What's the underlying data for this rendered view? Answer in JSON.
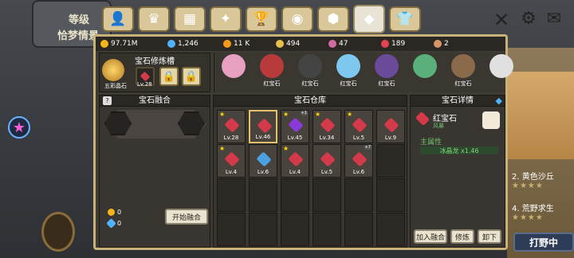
{
  "background": {
    "left_title": "等级",
    "left_sub": "恰梦情景",
    "right_items": [
      {
        "label": "2. 黄色沙丘",
        "stars": "★★★★"
      },
      {
        "label": "4. 荒野求生",
        "stars": "★★★★"
      }
    ],
    "hunt_button": "打野中"
  },
  "tabs": [
    {
      "icon": "character-icon",
      "glyph": "👤"
    },
    {
      "icon": "crown-icon",
      "glyph": "♛"
    },
    {
      "icon": "castle-icon",
      "glyph": "▦"
    },
    {
      "icon": "wand-icon",
      "glyph": "✦"
    },
    {
      "icon": "trophy-icon",
      "glyph": "🏆"
    },
    {
      "icon": "eye-orb-icon",
      "glyph": "◉"
    },
    {
      "icon": "shield-orb-icon",
      "glyph": "⬢"
    },
    {
      "icon": "gem-tab-icon",
      "glyph": "◆"
    },
    {
      "icon": "shirt-icon",
      "glyph": "👕"
    }
  ],
  "resources": [
    {
      "icon": "gold-icon",
      "value": "97.71M",
      "color": "#f3b519"
    },
    {
      "icon": "diamond-icon",
      "value": "1,246",
      "color": "#4fb3ff"
    },
    {
      "icon": "coin-icon",
      "value": "11 K",
      "color": "#f39a19"
    },
    {
      "icon": "wings-icon",
      "value": "494",
      "color": "#e6c04a"
    },
    {
      "icon": "ticket-icon",
      "value": "47",
      "color": "#d46aa3"
    },
    {
      "icon": "ruby-icon",
      "value": "189",
      "color": "#e04455"
    },
    {
      "icon": "donut-icon",
      "value": "2",
      "color": "#d99565"
    }
  ],
  "slot": {
    "title": "宝石修炼槽",
    "avatar_name": "五彩晶石",
    "gem_level": "Lv.28"
  },
  "monsters": [
    {
      "label": "",
      "color": "#e8a0c0"
    },
    {
      "label": "红宝石",
      "color": "#b83a3a"
    },
    {
      "label": "红宝石",
      "color": "#444"
    },
    {
      "label": "红宝石",
      "color": "#7ec8f0"
    },
    {
      "label": "红宝石",
      "color": "#6a4a9a"
    },
    {
      "label": "",
      "color": "#5ab07a"
    },
    {
      "label": "红宝石",
      "color": "#8a6a4a"
    },
    {
      "label": "",
      "color": "#e0e0e0"
    }
  ],
  "fusion": {
    "title": "宝石融合",
    "res1": "0",
    "res2": "0",
    "button": "开始融合"
  },
  "warehouse": {
    "title": "宝石仓库",
    "items": [
      {
        "lv": "Lv.28",
        "color": "#d43a4a",
        "star": true,
        "tag": ""
      },
      {
        "lv": "Lv.46",
        "color": "#d43a4a",
        "star": false,
        "tag": "",
        "selected": true
      },
      {
        "lv": "Lv.45",
        "color": "#8a3ad8",
        "star": true,
        "tag": "+1"
      },
      {
        "lv": "Lv.34",
        "color": "#d43a4a",
        "star": true,
        "tag": ""
      },
      {
        "lv": "Lv.5",
        "color": "#d43a4a",
        "star": true,
        "tag": ""
      },
      {
        "lv": "Lv.9",
        "color": "#d43a4a",
        "star": false,
        "tag": ""
      },
      {
        "lv": "Lv.4",
        "color": "#d43a4a",
        "star": true,
        "tag": ""
      },
      {
        "lv": "Lv.6",
        "color": "#4aa3e0",
        "star": false,
        "tag": ""
      },
      {
        "lv": "Lv.4",
        "color": "#d43a4a",
        "star": true,
        "tag": ""
      },
      {
        "lv": "Lv.5",
        "color": "#d43a4a",
        "star": false,
        "tag": ""
      },
      {
        "lv": "Lv.6",
        "color": "#d43a4a",
        "star": false,
        "tag": "+7"
      }
    ]
  },
  "detail": {
    "title": "宝石详情",
    "gem_name": "红宝石",
    "gem_sub": "风暴",
    "main_attr": "主属性",
    "attr_value": "冰晶龙 x1.46",
    "buttons": [
      "加入融合",
      "修炼",
      "卸下"
    ]
  }
}
